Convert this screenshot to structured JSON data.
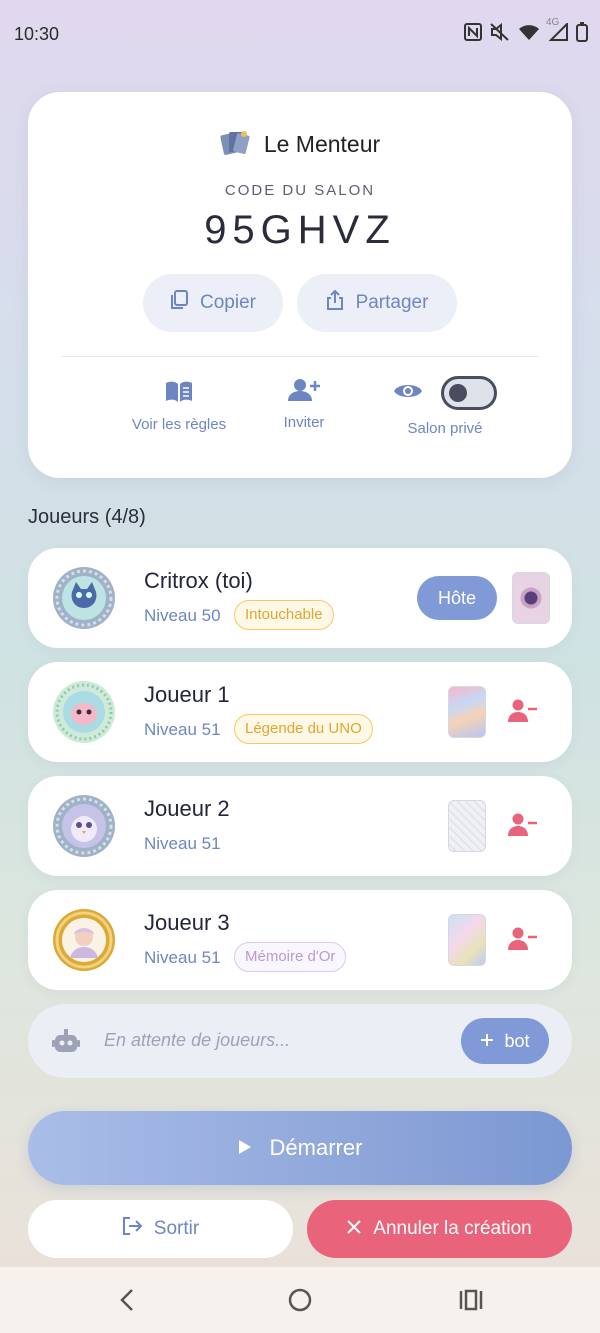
{
  "status_bar": {
    "time": "10:30",
    "icons": [
      "nfc-icon",
      "mute-icon",
      "wifi-icon",
      "signal-4g-icon",
      "battery-icon"
    ],
    "network": "4G"
  },
  "room": {
    "game_icon": "cards-icon",
    "game_title": "Le Menteur",
    "code_label": "CODE DU SALON",
    "code": "95GHVZ",
    "copy_label": "Copier",
    "share_label": "Partager",
    "rules_label": "Voir les règles",
    "invite_label": "Inviter",
    "private_label": "Salon privé",
    "private_enabled": false
  },
  "players": {
    "heading": "Joueurs (4/8)",
    "list": [
      {
        "name": "Critrox (toi)",
        "level": "Niveau 50",
        "badge": "Intouchable",
        "host_label": "Hôte",
        "badge_style": "gold"
      },
      {
        "name": "Joueur 1",
        "level": "Niveau 51",
        "badge": "Légende du UNO",
        "badge_style": "gold"
      },
      {
        "name": "Joueur 2",
        "level": "Niveau 51"
      },
      {
        "name": "Joueur 3",
        "level": "Niveau 51",
        "badge": "Mémoire d'Or",
        "badge_style": "purple"
      }
    ]
  },
  "waiting": {
    "text": "En attente de joueurs...",
    "bot_label": "bot"
  },
  "actions": {
    "start_label": "Démarrer",
    "leave_label": "Sortir",
    "cancel_label": "Annuler la création"
  },
  "colors": {
    "accent": "#7f9ad6",
    "danger": "#e9637a",
    "gold_badge": "#e0a630",
    "text": "#23263a"
  }
}
